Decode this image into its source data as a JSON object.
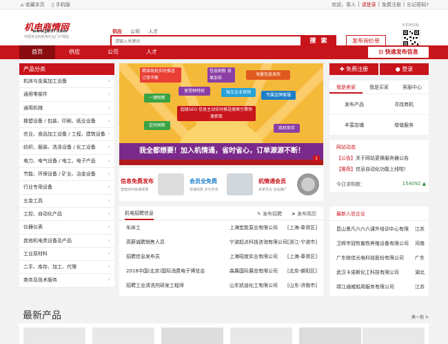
{
  "topbar": {
    "bookmark": "收藏本页",
    "mobile": "手机版",
    "welcome": "欢迎，客人",
    "sep": "|",
    "login": "请登录",
    "register": "免费注册",
    "forgot": "忘记密码?"
  },
  "header": {
    "logo_name": "机电商情网",
    "logo_url": "www.JD37.com",
    "logo_slogan": "中国专业的机电行业门户网站",
    "search_tabs": [
      "供应",
      "公司",
      "人才"
    ],
    "search_placeholder": "请输入关键词",
    "search_button": "搜 索",
    "ask_price": "发布询价单",
    "qr_label": "手机微信版"
  },
  "nav": {
    "items": [
      "首页",
      "供应",
      "公司",
      "人才"
    ],
    "publish": "快速发布信息"
  },
  "categories": {
    "title": "产品分类",
    "items": [
      "机床与金属加工设备",
      "通用零部件",
      "通用机械",
      "橡塑设备 / 包装、印刷、纸业设备",
      "农业、食品加工设备 / 工程、建筑设备",
      "纺织、服装、洗涤设备 / 化工设备",
      "电力、电气设备 / 电工、电子产品",
      "节能、环保设备 / 矿业、冶金设备",
      "行业专用设备",
      "五金工具",
      "工控、自动化产品",
      "仪器仪表",
      "其他机电类设备及产品",
      "工业原材料",
      "二手、库存、加工、代理",
      "商务及技术服务"
    ]
  },
  "banner": {
    "cards": [
      "精准商机实时推送 订单不断",
      "信息刷新 效果加倍",
      "海量信息发布",
      "享受种特权",
      "独立企业官网",
      "专属金牌客服",
      "一键刷新",
      "超级SEO 信息主动实时推送搜索引擎快速抓取",
      "定时刷新",
      "商机助手"
    ],
    "slogan": "我全都想要！加入机情通，省时省心，订单源源不断！",
    "page": "1"
  },
  "promos": [
    {
      "title": "信息免费发布",
      "sub": "智能SEO快速收录"
    },
    {
      "title": "会员全免费",
      "sub": "快速收款 多元手法"
    },
    {
      "title": "机情通会员",
      "sub": "买家优先 全站推广"
    }
  ],
  "jobs": {
    "title": "机电招聘信息",
    "post_job": "发布招聘",
    "post_resume": "发布简历",
    "rows": [
      {
        "title": "车床工",
        "company": "上海宏胜泵业有限公司",
        "loc": "[上海-奉贤区]"
      },
      {
        "title": "高薪诚聘销售人员",
        "company": "宁波起点科技咨询有限公司",
        "loc": "[浙江-宁波市]"
      },
      {
        "title": "招聘信息发布员",
        "company": "上海昭度实业有限公司",
        "loc": "[上海-奉贤区]"
      },
      {
        "title": "2018中国(北京)国际消费电子博览会",
        "company": "森展国际展览有限公司",
        "loc": "[北京-朝阳区]"
      },
      {
        "title": "招聘工业清洗剂研发工程师",
        "company": "山东凯迪化工有限公司",
        "loc": "[山东-济南市]"
      }
    ]
  },
  "right": {
    "buttons": [
      "免费注册",
      "登录"
    ],
    "tabs": [
      "我是卖家",
      "我是买家",
      "客服中心"
    ],
    "grid": [
      "发布产品",
      "寻找商机",
      "丰富店铺",
      "增值服务"
    ],
    "news_title": "网站动态",
    "news": [
      {
        "tag": "【公告】",
        "text": "关于网站更换服务器公告"
      },
      {
        "tag": "【推荐】",
        "text": "信息自动化功能上线啦！"
      }
    ],
    "count_label": "今日求购数：",
    "count_value": "154092"
  },
  "firms": {
    "title": "最新入驻企业",
    "rows": [
      {
        "name": "昆山墨凡六六六课外培训中心有限",
        "prov": "江苏"
      },
      {
        "name": "卫辉市冠牧畜牧养殖设备有限公司",
        "prov": "河南"
      },
      {
        "name": "广东统佳光电科技股份有限公司",
        "prov": "广东"
      },
      {
        "name": "武汉卡诺斯化工科技有限公司",
        "prov": "湖北"
      },
      {
        "name": "靖江通威船用服务有限公司",
        "prov": "江苏"
      }
    ]
  },
  "latest": {
    "title": "最新产品",
    "switch": "换一批"
  }
}
